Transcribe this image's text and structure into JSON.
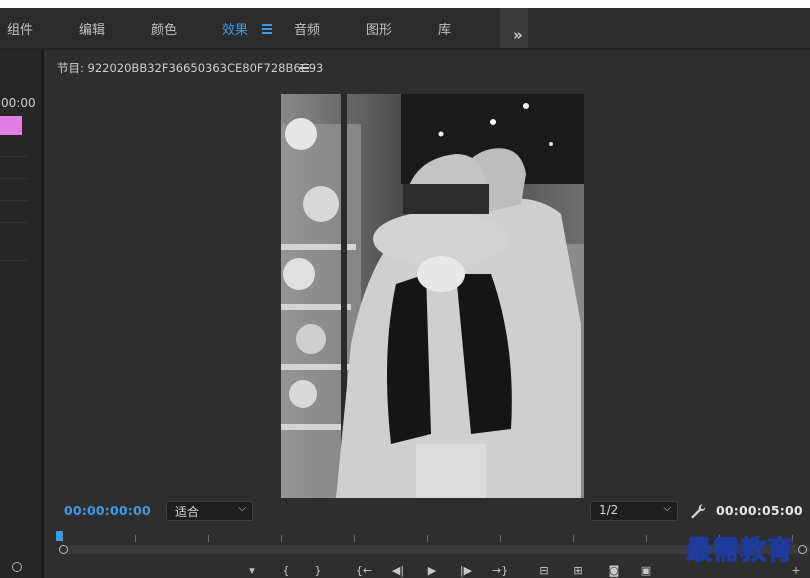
{
  "menu": {
    "items": [
      {
        "label": "组件",
        "active": false
      },
      {
        "label": "编辑",
        "active": false
      },
      {
        "label": "颜色",
        "active": false
      },
      {
        "label": "效果",
        "active": true
      },
      {
        "label": "音频",
        "active": false
      },
      {
        "label": "图形",
        "active": false
      },
      {
        "label": "库",
        "active": false
      }
    ],
    "active_menu_icon": "hamburger-menu-icon",
    "more_icon": "double-chevron-right-icon"
  },
  "left_panel": {
    "timecode": "00:00",
    "clip_color": "#e27ee2"
  },
  "program_monitor": {
    "title": "节目: 922020BB32F36650363CE80F728B6C93",
    "title_menu_icon": "hamburger-menu-icon",
    "current_timecode": "00:00:00:00",
    "duration_timecode": "00:00:05:00",
    "zoom_dropdown": {
      "value": "适合"
    },
    "resolution_dropdown": {
      "value": "1/2"
    },
    "settings_icon": "wrench-icon",
    "accent_color": "#3d9ae8",
    "controls": [
      {
        "name": "add-marker-icon",
        "glyph": "▾"
      },
      {
        "name": "mark-in-icon",
        "glyph": "{"
      },
      {
        "name": "mark-out-icon",
        "glyph": "}"
      },
      {
        "name": "go-to-in-icon",
        "glyph": "{←"
      },
      {
        "name": "step-back-icon",
        "glyph": "◀|"
      },
      {
        "name": "play-icon",
        "glyph": "▶"
      },
      {
        "name": "step-forward-icon",
        "glyph": "|▶"
      },
      {
        "name": "go-to-out-icon",
        "glyph": "→}"
      },
      {
        "name": "lift-icon",
        "glyph": "⊟"
      },
      {
        "name": "extract-icon",
        "glyph": "⊞"
      },
      {
        "name": "export-frame-icon",
        "glyph": "◙"
      },
      {
        "name": "comparison-view-icon",
        "glyph": "▣"
      },
      {
        "name": "add-button-icon",
        "glyph": "+"
      }
    ]
  },
  "watermark": {
    "text": "最需教育",
    "stroke_color": "#1e3a9a"
  }
}
